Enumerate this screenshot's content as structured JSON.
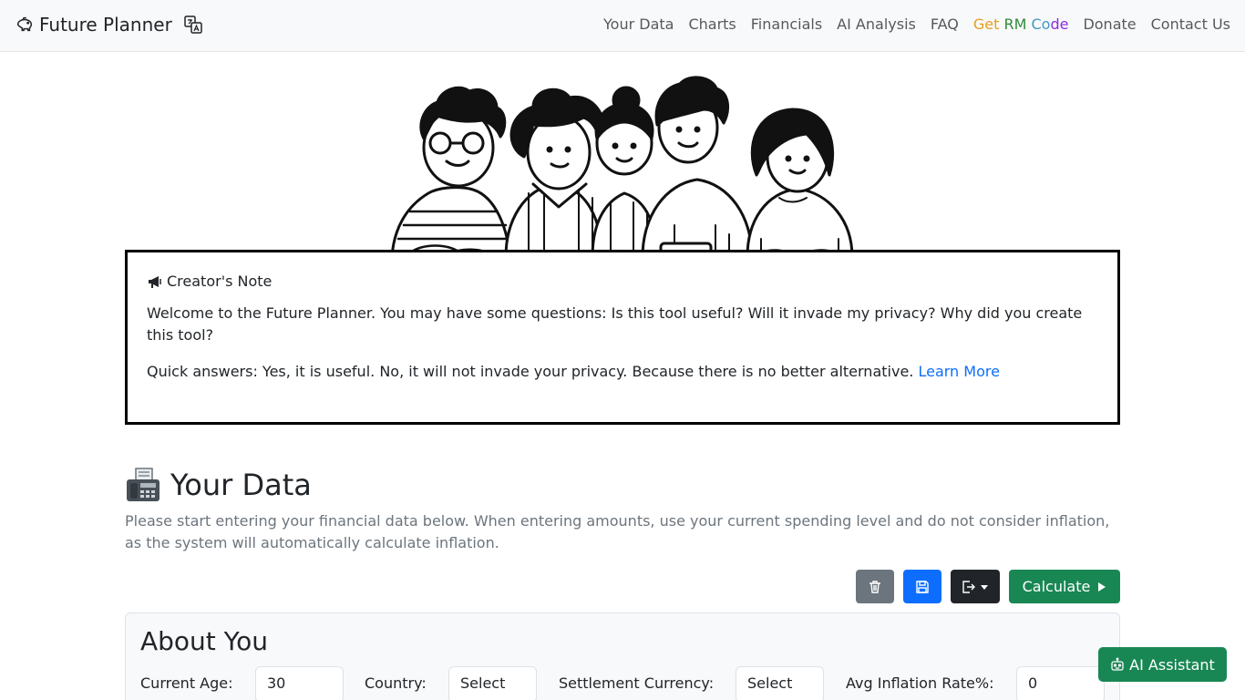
{
  "navbar": {
    "brand": "Future Planner",
    "links": [
      "Your Data",
      "Charts",
      "Financials",
      "AI Analysis",
      "FAQ"
    ],
    "rm_code": {
      "w1": "Get",
      "w2": "RM",
      "w3a": "Co",
      "w3b": "de"
    },
    "links_after": [
      "Donate",
      "Contact Us"
    ]
  },
  "note": {
    "title": "Creator's Note",
    "paragraph1": "Welcome to the Future Planner. You may have some questions: Is this tool useful? Will it invade my privacy? Why did you create this tool?",
    "paragraph2": "Quick answers: Yes, it is useful. No, it will not invade your privacy. Because there is no better alternative.",
    "learn_more": "Learn More"
  },
  "your_data": {
    "title": "Your Data",
    "description": "Please start entering your financial data below. When entering amounts, use your current spending level and do not consider inflation, as the system will automatically calculate inflation.",
    "calculate_label": "Calculate"
  },
  "about_you": {
    "title": "About You",
    "current_age_label": "Current Age:",
    "current_age_value": "30",
    "country_label": "Country:",
    "country_value": "Select",
    "currency_label": "Settlement Currency:",
    "currency_value": "Select",
    "inflation_label": "Avg Inflation Rate%:",
    "inflation_value": "0"
  },
  "ai_assistant": {
    "label": "AI Assistant"
  },
  "colors": {
    "primary": "#0d6efd",
    "success": "#198754",
    "secondary": "#6c757d",
    "dark": "#212529"
  },
  "icons": [
    "piggy-bank-icon",
    "translate-icon",
    "megaphone-icon",
    "fax-icon",
    "trash-icon",
    "floppy-disk-icon",
    "export-icon",
    "play-icon",
    "robot-icon"
  ]
}
